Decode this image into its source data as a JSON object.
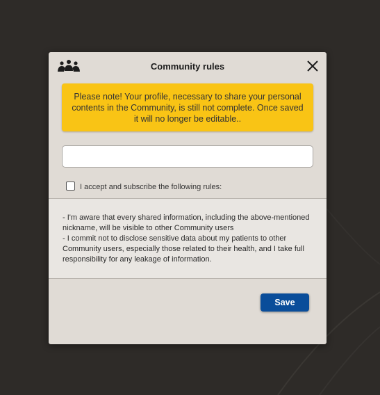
{
  "dialog": {
    "title": "Community rules",
    "header_icon": "community-icon",
    "close_icon": "close-icon"
  },
  "warning": {
    "text": "Please note! Your profile, necessary to share your personal contents in the Community, is still not complete. Once saved it will no longer be editable..",
    "color": "#f9c415"
  },
  "nickname": {
    "value": "",
    "placeholder": ""
  },
  "accept": {
    "label": "I accept and subscribe the following rules:",
    "checked": false
  },
  "rules": [
    "- I'm aware that every shared information, including the above-mentioned nickname, will be visible to other Community users",
    "- I commit not to disclose sensitive data about my patients to other Community users, especially those related to their health, and I take full responsibility for any leakage of information."
  ],
  "actions": {
    "save_label": "Save",
    "save_color": "#0a4d9a"
  }
}
